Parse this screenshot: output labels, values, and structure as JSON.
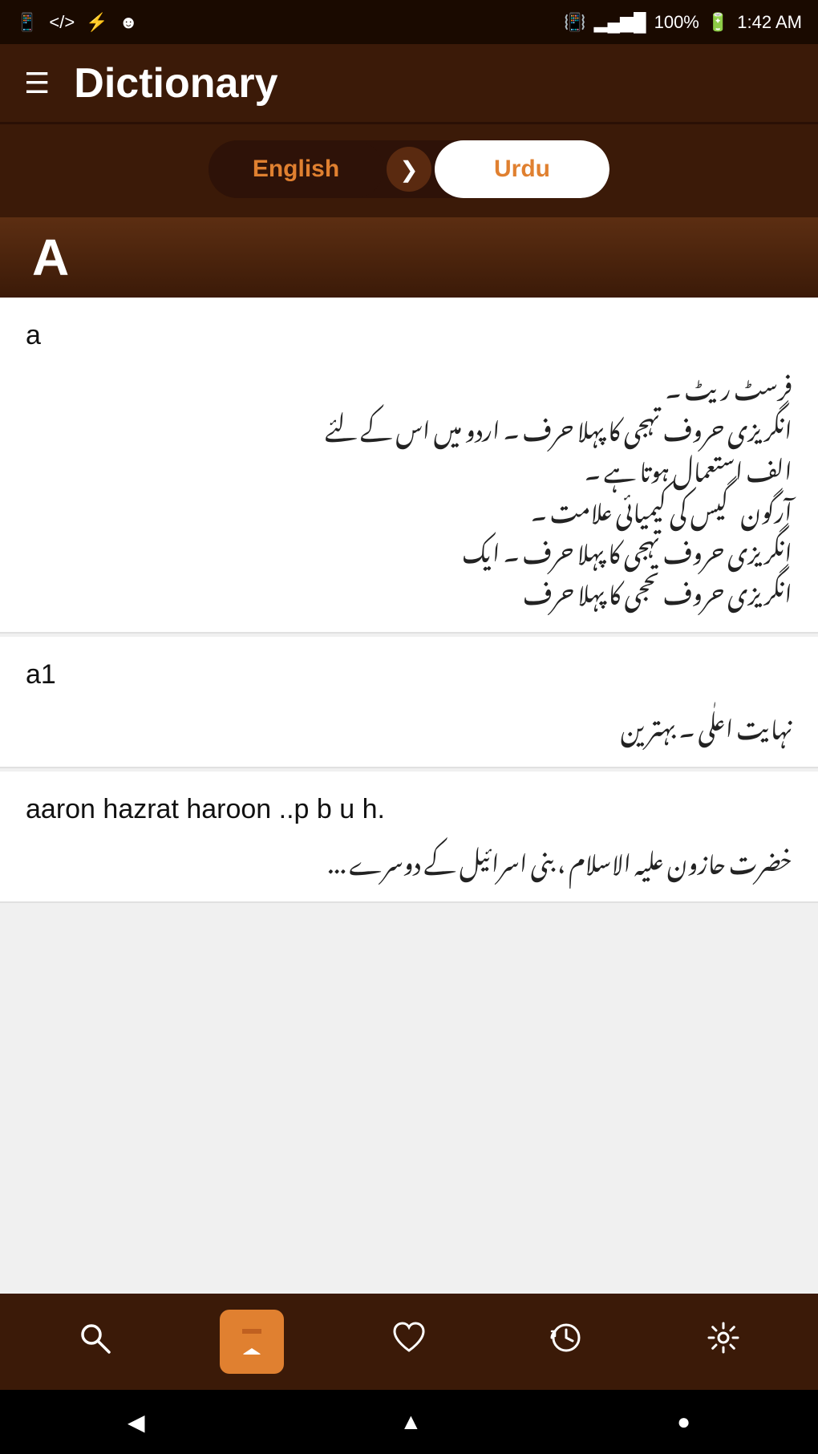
{
  "statusBar": {
    "time": "1:42 AM",
    "battery": "100%",
    "signal": "▂▄▆█",
    "icons": [
      "□",
      "</>",
      "⚡",
      "☻"
    ]
  },
  "toolbar": {
    "title": "Dictionary",
    "menuIcon": "☰"
  },
  "languageToggle": {
    "activeLabel": "English",
    "inactiveLabel": "Urdu",
    "arrowIcon": "❯"
  },
  "sectionHeader": {
    "letter": "A"
  },
  "entries": [
    {
      "word": "a",
      "definition": "فرسٹ ریٹ ۔\nانگریزی حروف تہجی کا پہلا حرف ۔ اردو میں اس کے لئے\nالف استعمال ہوتا ہے ۔\nآرگون گیس کی کیمیائی علامت ۔\nانگریزی حروف تہجی کا پہلا حرف ۔ ایک\nانگریزی حروف تحجی کا پہلا حرف"
    },
    {
      "word": "a1",
      "definition": "نہایت اعلٰی ۔ بہترین"
    },
    {
      "word": "aaron hazrat haroon ..p b u h.",
      "definition": "خضرت حازون علیہ الاسلام ، بنی اسرائیل کے دوسرے ..."
    }
  ],
  "bottomNav": {
    "items": [
      {
        "icon": "🔍",
        "label": "search",
        "active": false
      },
      {
        "icon": "🔖",
        "label": "bookmark",
        "active": true
      },
      {
        "icon": "♡",
        "label": "favorites",
        "active": false
      },
      {
        "icon": "↺",
        "label": "history",
        "active": false
      },
      {
        "icon": "⚙",
        "label": "settings",
        "active": false
      }
    ]
  },
  "systemNav": {
    "back": "◀",
    "home": "▲",
    "recent": "●"
  }
}
